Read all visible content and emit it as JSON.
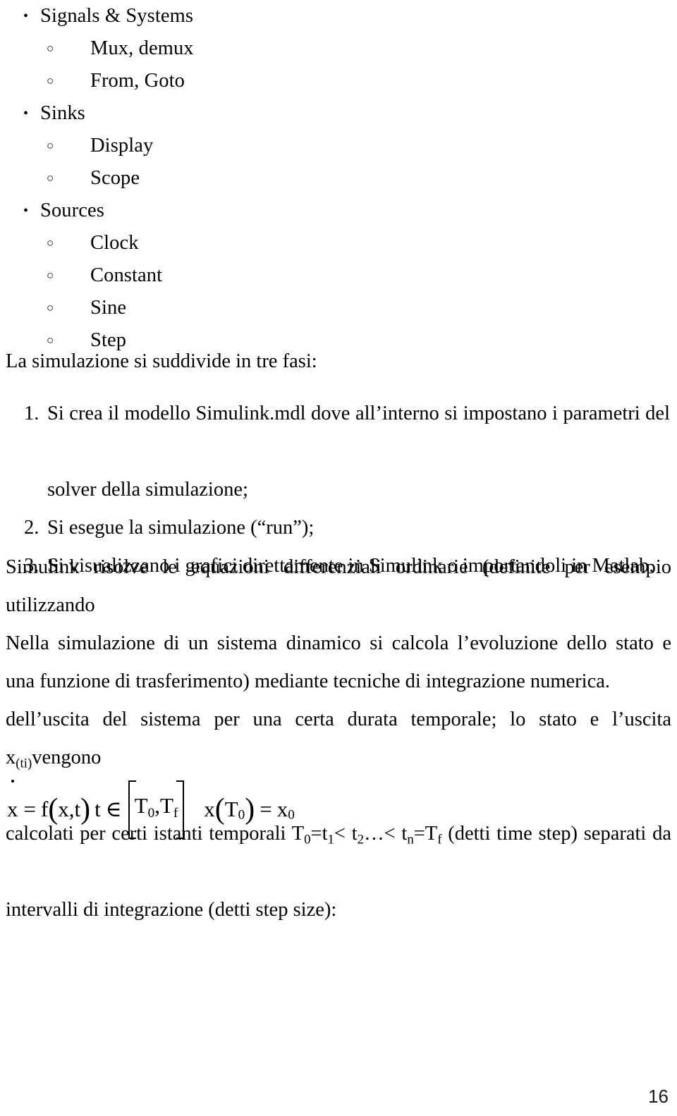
{
  "document": {
    "page_number": "16",
    "bullet_sections": [
      {
        "marker": "•",
        "label": "Signals & Systems",
        "children": [
          {
            "marker": "○",
            "label": "Mux, demux"
          },
          {
            "marker": "○",
            "label": "From, Goto"
          }
        ]
      },
      {
        "marker": "•",
        "label": "Sinks",
        "children": [
          {
            "marker": "○",
            "label": "Display"
          },
          {
            "marker": "○",
            "label": "Scope"
          }
        ]
      },
      {
        "marker": "•",
        "label": "Sources",
        "children": [
          {
            "marker": "○",
            "label": "Clock"
          },
          {
            "marker": "○",
            "label": "Constant"
          },
          {
            "marker": "○",
            "label": "Sine"
          },
          {
            "marker": "○",
            "label": "Step"
          }
        ]
      }
    ],
    "lead_text": "La simulazione si suddivide in tre fasi:",
    "ordered_list": [
      {
        "number": "1.",
        "line1": "Si crea il modello Simulink.mdl dove all’interno si impostano i parametri del",
        "line2": "solver della simulazione;"
      },
      {
        "number": "2.",
        "line1": "Si esegue la simulazione (“run”);",
        "line2": ""
      },
      {
        "number": "3.",
        "line1": "Si visualizzano i grafici direttamente in Simulink o importandoli in Matlab.",
        "line2": ""
      }
    ],
    "paragraph_1": {
      "line1": "Simulink risolve le equazioni differenziali ordinarie (definite per esempio utilizzando",
      "line2": "una funzione di trasferimento) mediante tecniche di integrazione numerica."
    },
    "paragraph_2": {
      "line1": "Nella simulazione di un sistema dinamico si calcola l’evoluzione dello stato e",
      "line2_a": "dell’uscita del sistema per una certa durata temporale; lo stato e l’uscita x",
      "line2_sub": "(ti)",
      "line2_b": "vengono",
      "line3_a": "calcolati per certi istanti temporali T",
      "line3_sub1": "0",
      "line3_b": "=t",
      "line3_sub2": "1",
      "line3_c": "< t",
      "line3_sub3": "2",
      "line3_d": "…< t",
      "line3_sub4": "n",
      "line3_e": "=T",
      "line3_sub5": "f",
      "line3_f": " (detti time step) separati da",
      "line4": "intervalli di integrazione (detti step size):"
    },
    "equation": {
      "xdot": "x",
      "eq1": "=",
      "f": "f",
      "open_paren": "(",
      "args": "x,t",
      "close_paren": ")",
      "t": "t",
      "in": "∈",
      "bracket_T0": "T",
      "bracket_T0_sub": "0",
      "bracket_comma": ",T",
      "bracket_Tf_sub": "f",
      "x2": "x",
      "open_paren2": "(",
      "T0b": "T",
      "T0b_sub": "0",
      "close_paren2": ")",
      "eq2": "=",
      "x0": "x",
      "x0_sub": "0"
    }
  }
}
